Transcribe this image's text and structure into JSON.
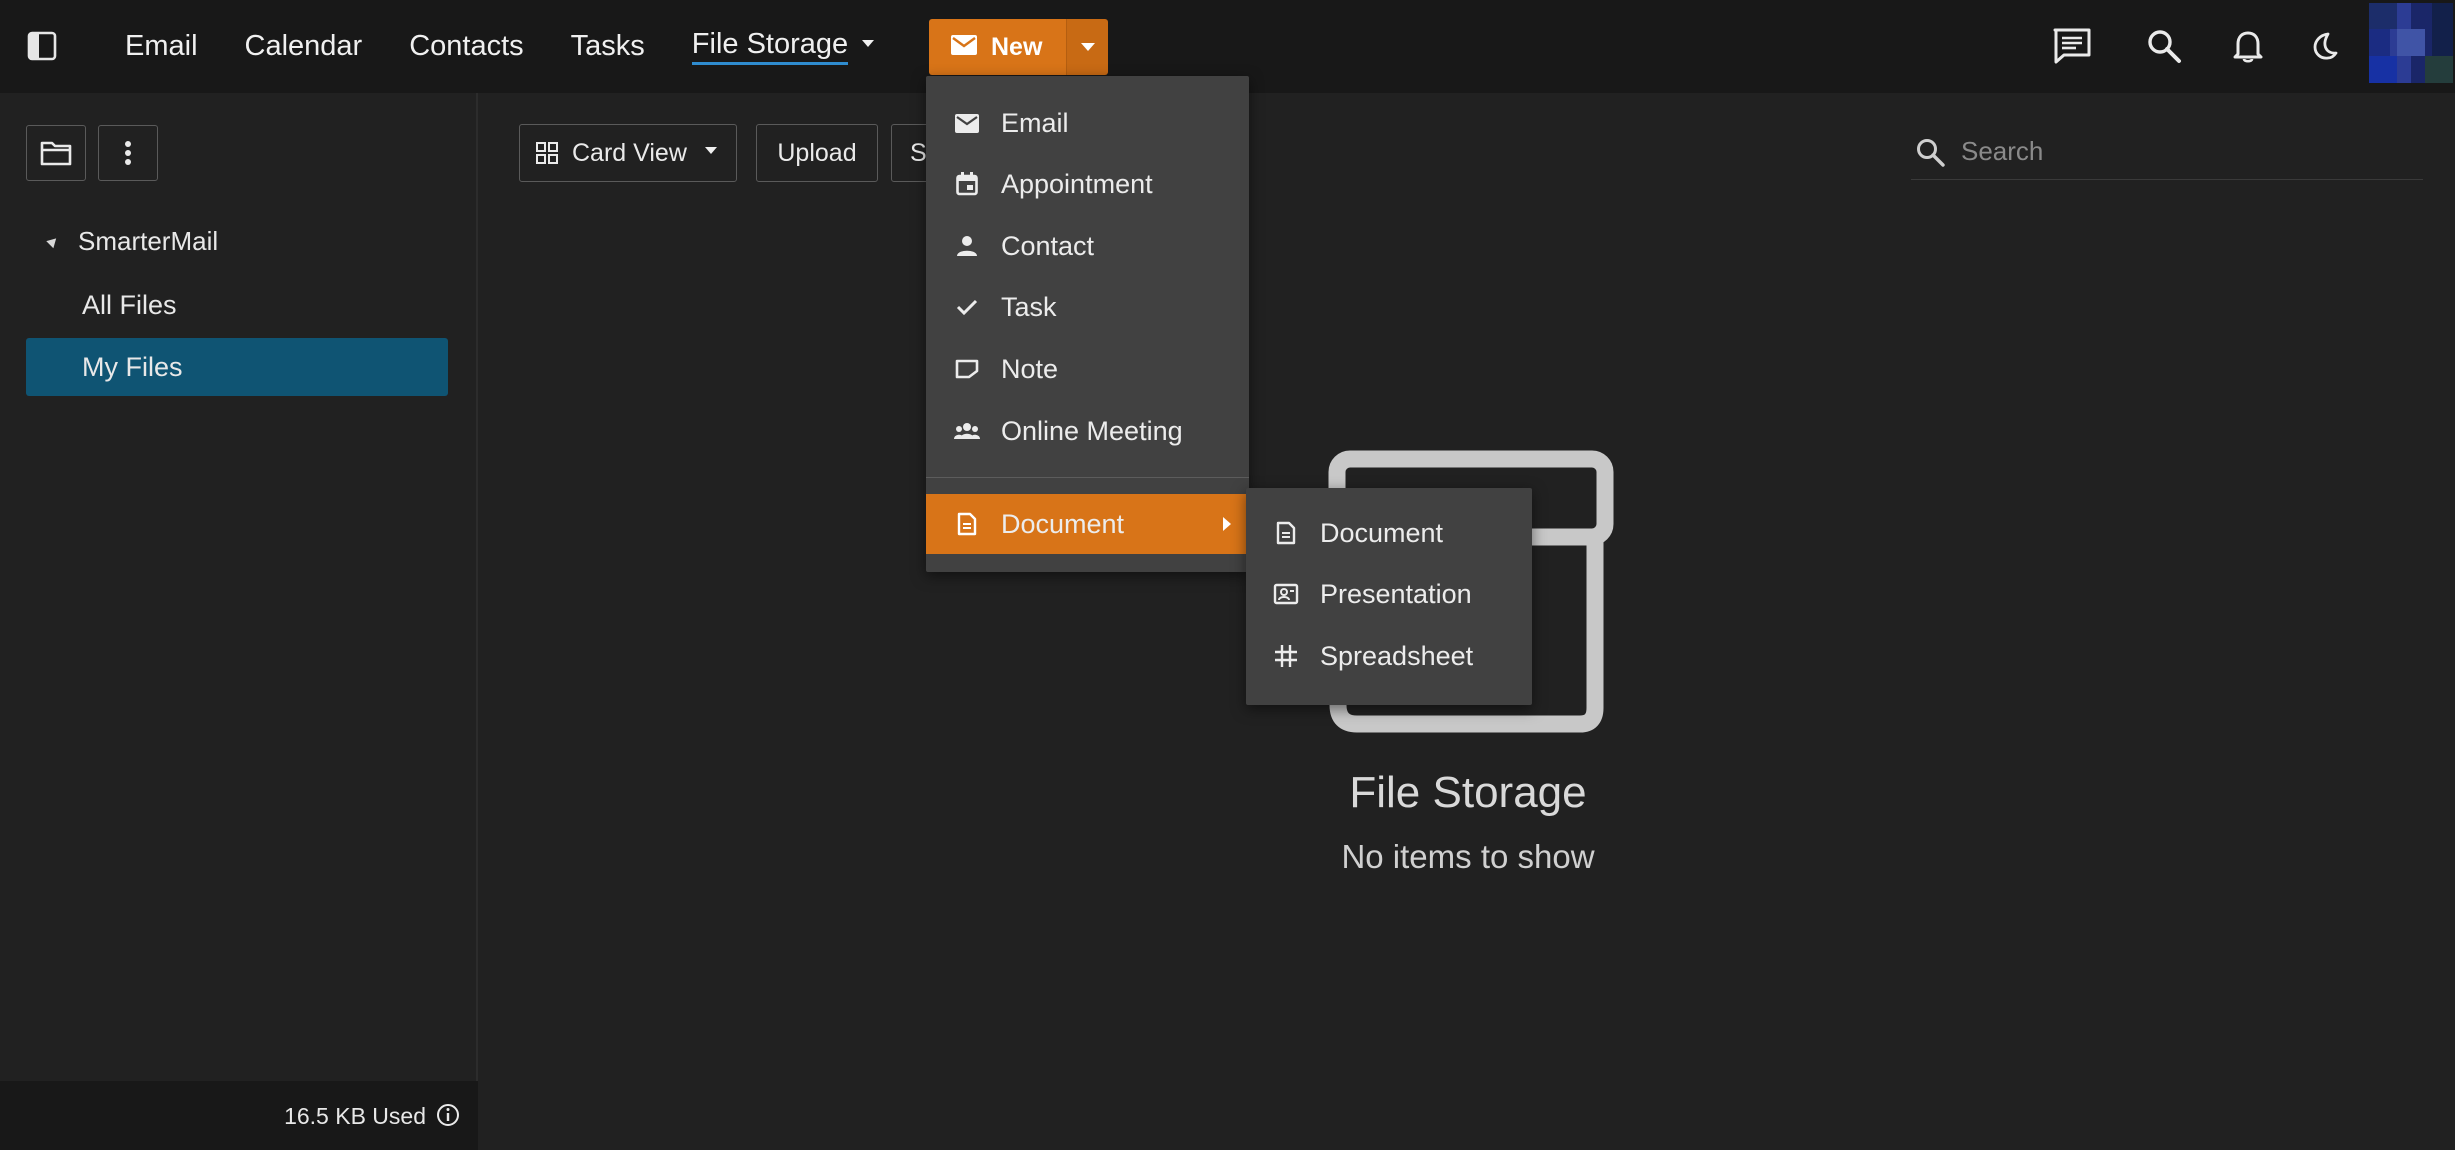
{
  "colors": {
    "accent": "#d87418",
    "selected": "#0f5473",
    "background": "#212121",
    "topbar": "#181818",
    "menu": "#414141"
  },
  "topbar": {
    "nav": [
      {
        "label": "Email"
      },
      {
        "label": "Calendar"
      },
      {
        "label": "Contacts"
      },
      {
        "label": "Tasks"
      },
      {
        "label": "File Storage",
        "active": true
      }
    ],
    "new_label": "New",
    "icons": [
      "panel-toggle-icon",
      "chat-icon",
      "search-icon",
      "bell-icon",
      "moon-icon"
    ]
  },
  "sidebar": {
    "root_label": "SmarterMail",
    "items": [
      {
        "label": "All Files"
      },
      {
        "label": "My Files",
        "selected": true
      }
    ],
    "storage_used": "16.5 KB Used"
  },
  "toolbar": {
    "view_label": "Card View",
    "upload_label": "Upload",
    "partial_label": "S"
  },
  "search": {
    "placeholder": "Search"
  },
  "empty_state": {
    "title": "File Storage",
    "subtitle": "No items to show"
  },
  "new_menu": {
    "items": [
      {
        "label": "Email",
        "icon": "envelope-icon"
      },
      {
        "label": "Appointment",
        "icon": "calendar-icon"
      },
      {
        "label": "Contact",
        "icon": "person-icon"
      },
      {
        "label": "Task",
        "icon": "check-icon"
      },
      {
        "label": "Note",
        "icon": "note-icon"
      },
      {
        "label": "Online Meeting",
        "icon": "group-icon"
      }
    ],
    "document_label": "Document",
    "submenu": [
      {
        "label": "Document",
        "icon": "document-icon"
      },
      {
        "label": "Presentation",
        "icon": "presentation-icon"
      },
      {
        "label": "Spreadsheet",
        "icon": "spreadsheet-icon"
      }
    ]
  }
}
